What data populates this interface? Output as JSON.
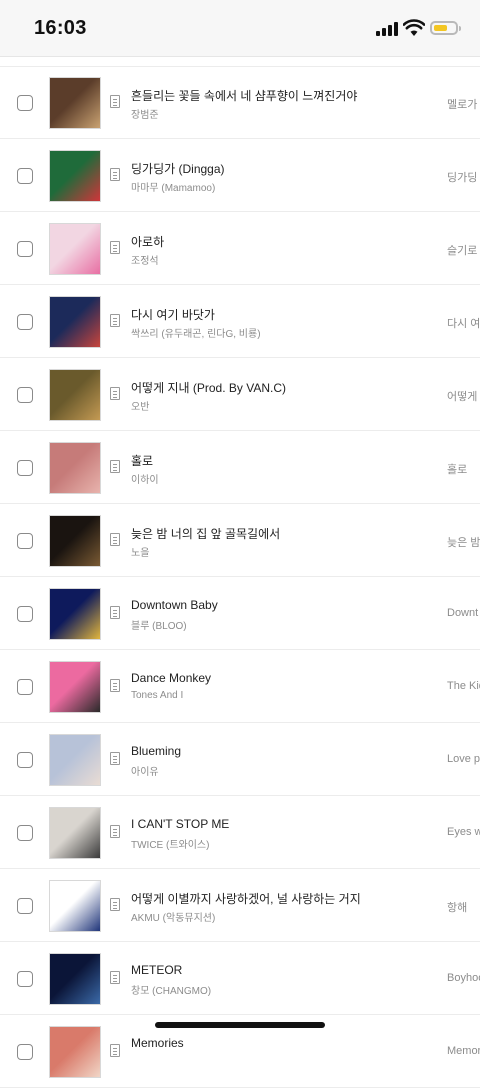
{
  "status": {
    "time": "16:03"
  },
  "songs": [
    {
      "title": "흔들리는 꽃들 속에서 네 샴푸향이 느껴진거야",
      "artist": "장범준",
      "album": "멜로가",
      "cover": [
        "#5b3d2a",
        "#c9a272"
      ]
    },
    {
      "title": "딩가딩가 (Dingga)",
      "artist": "마마무 (Mamamoo)",
      "album": "딩가딩",
      "cover": [
        "#1f6b3a",
        "#d0353a"
      ]
    },
    {
      "title": "아로하",
      "artist": "조정석",
      "album": "슬기로",
      "cover": [
        "#f2d6e2",
        "#e86fa3"
      ]
    },
    {
      "title": "다시 여기 바닷가",
      "artist": "싹쓰리 (유두래곤, 린다G, 비룡)",
      "album": "다시 여",
      "cover": [
        "#1c2a5a",
        "#c8453c"
      ]
    },
    {
      "title": "어떻게 지내 (Prod. By VAN.C)",
      "artist": "오반",
      "album": "어떻게",
      "cover": [
        "#6a5a2c",
        "#c49a53"
      ]
    },
    {
      "title": "홀로",
      "artist": "이하이",
      "album": "홀로",
      "cover": [
        "#c67b79",
        "#e8b3ad"
      ]
    },
    {
      "title": "늦은 밤 너의 집 앞 골목길에서",
      "artist": "노을",
      "album": "늦은 밤",
      "cover": [
        "#1a1410",
        "#7a5a33"
      ]
    },
    {
      "title": "Downtown Baby",
      "artist": "블루 (BLOO)",
      "album": "Downt",
      "cover": [
        "#0e1a5c",
        "#e1b53c"
      ]
    },
    {
      "title": "Dance Monkey",
      "artist": "Tones And I",
      "album": "The Kid",
      "cover": [
        "#ec6aa0",
        "#2a2a2a"
      ]
    },
    {
      "title": "Blueming",
      "artist": "아이유",
      "album": "Love p",
      "cover": [
        "#b7c2d8",
        "#e9dcd4"
      ]
    },
    {
      "title": "I CAN'T STOP ME",
      "artist": "TWICE (트와이스)",
      "album": "Eyes w",
      "cover": [
        "#d9d5cf",
        "#3a3a3a"
      ]
    },
    {
      "title": "어떻게 이별까지 사랑하겠어, 널 사랑하는 거지",
      "artist": "AKMU (악동뮤지션)",
      "album": "항해",
      "cover": [
        "#ffffff",
        "#20357a"
      ]
    },
    {
      "title": "METEOR",
      "artist": "창모 (CHANGMO)",
      "album": "Boyhoo",
      "cover": [
        "#0b1538",
        "#3b6aa8"
      ]
    },
    {
      "title": "Memories",
      "artist": "",
      "album": "Memor",
      "cover": [
        "#d97a6a",
        "#f1d6c7"
      ]
    }
  ]
}
